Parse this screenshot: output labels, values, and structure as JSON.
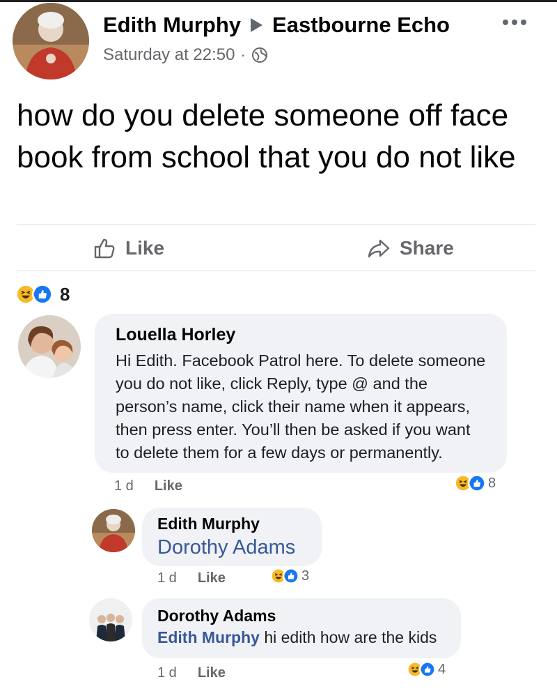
{
  "post": {
    "author": "Edith Murphy",
    "group": "Eastbourne Echo",
    "timestamp": "Saturday at 22:50",
    "separator": "·",
    "privacy_icon": "globe-icon",
    "text": "how do you delete someone off face book from school that you do not like",
    "actions": {
      "like": "Like",
      "share": "Share"
    },
    "reactions": {
      "icons": [
        "haha-icon",
        "like-icon"
      ],
      "count": "8"
    }
  },
  "comments": [
    {
      "author": "Louella Horley",
      "text": "Hi Edith. Facebook Patrol here. To delete someone you do not like, click Reply, type @ and the person’s name, click their name when it appears, then press enter. You’ll then be asked if you want to delete them for a few days or permanently.",
      "age": "1 d",
      "like_label": "Like",
      "reaction_count": "8"
    },
    {
      "author": "Edith Murphy",
      "mention": "Dorothy Adams",
      "age": "1 d",
      "like_label": "Like",
      "reaction_count": "3"
    },
    {
      "author": "Dorothy Adams",
      "mention": "Edith Murphy",
      "text": " hi edith how are the kids",
      "age": "1 d",
      "like_label": "Like",
      "reaction_count": "4"
    }
  ],
  "colors": {
    "link": "#385898",
    "like_blue": "#1877f2",
    "haha_yellow": "#f7b928",
    "secondary_text": "#65676b",
    "bubble_bg": "#f0f2f5"
  }
}
